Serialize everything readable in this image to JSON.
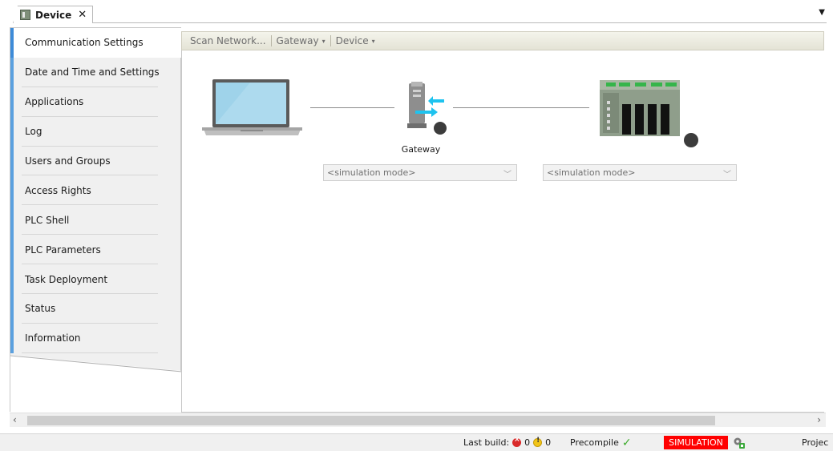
{
  "tab": {
    "title": "Device",
    "close": "✕",
    "dropdown": "▼"
  },
  "nav": {
    "items": [
      {
        "label": "Communication Settings",
        "active": true
      },
      {
        "label": "Date and Time and Settings"
      },
      {
        "label": "Applications"
      },
      {
        "label": "Log"
      },
      {
        "label": "Users and Groups"
      },
      {
        "label": "Access Rights"
      },
      {
        "label": "PLC Shell"
      },
      {
        "label": "PLC Parameters"
      },
      {
        "label": "Task Deployment"
      },
      {
        "label": "Status"
      },
      {
        "label": "Information"
      }
    ]
  },
  "toolbar": {
    "scan": "Scan Network...",
    "gateway": "Gateway",
    "device": "Device",
    "caret": "▾"
  },
  "diagram": {
    "gateway_label": "Gateway",
    "gateway_select": "<simulation mode>",
    "device_select": "<simulation mode>",
    "chevron": "﹀"
  },
  "scroll": {
    "left": "‹",
    "right": "›"
  },
  "status": {
    "last_build": "Last build:",
    "errors": "0",
    "warnings": "0",
    "precompile": "Precompile",
    "check": "✓",
    "simulation": "SIMULATION",
    "project": "Projec"
  },
  "colors": {
    "accent": "#3d8bd8",
    "simulation": "#ff0000",
    "gateway_arrows": "#1ec3ef"
  }
}
